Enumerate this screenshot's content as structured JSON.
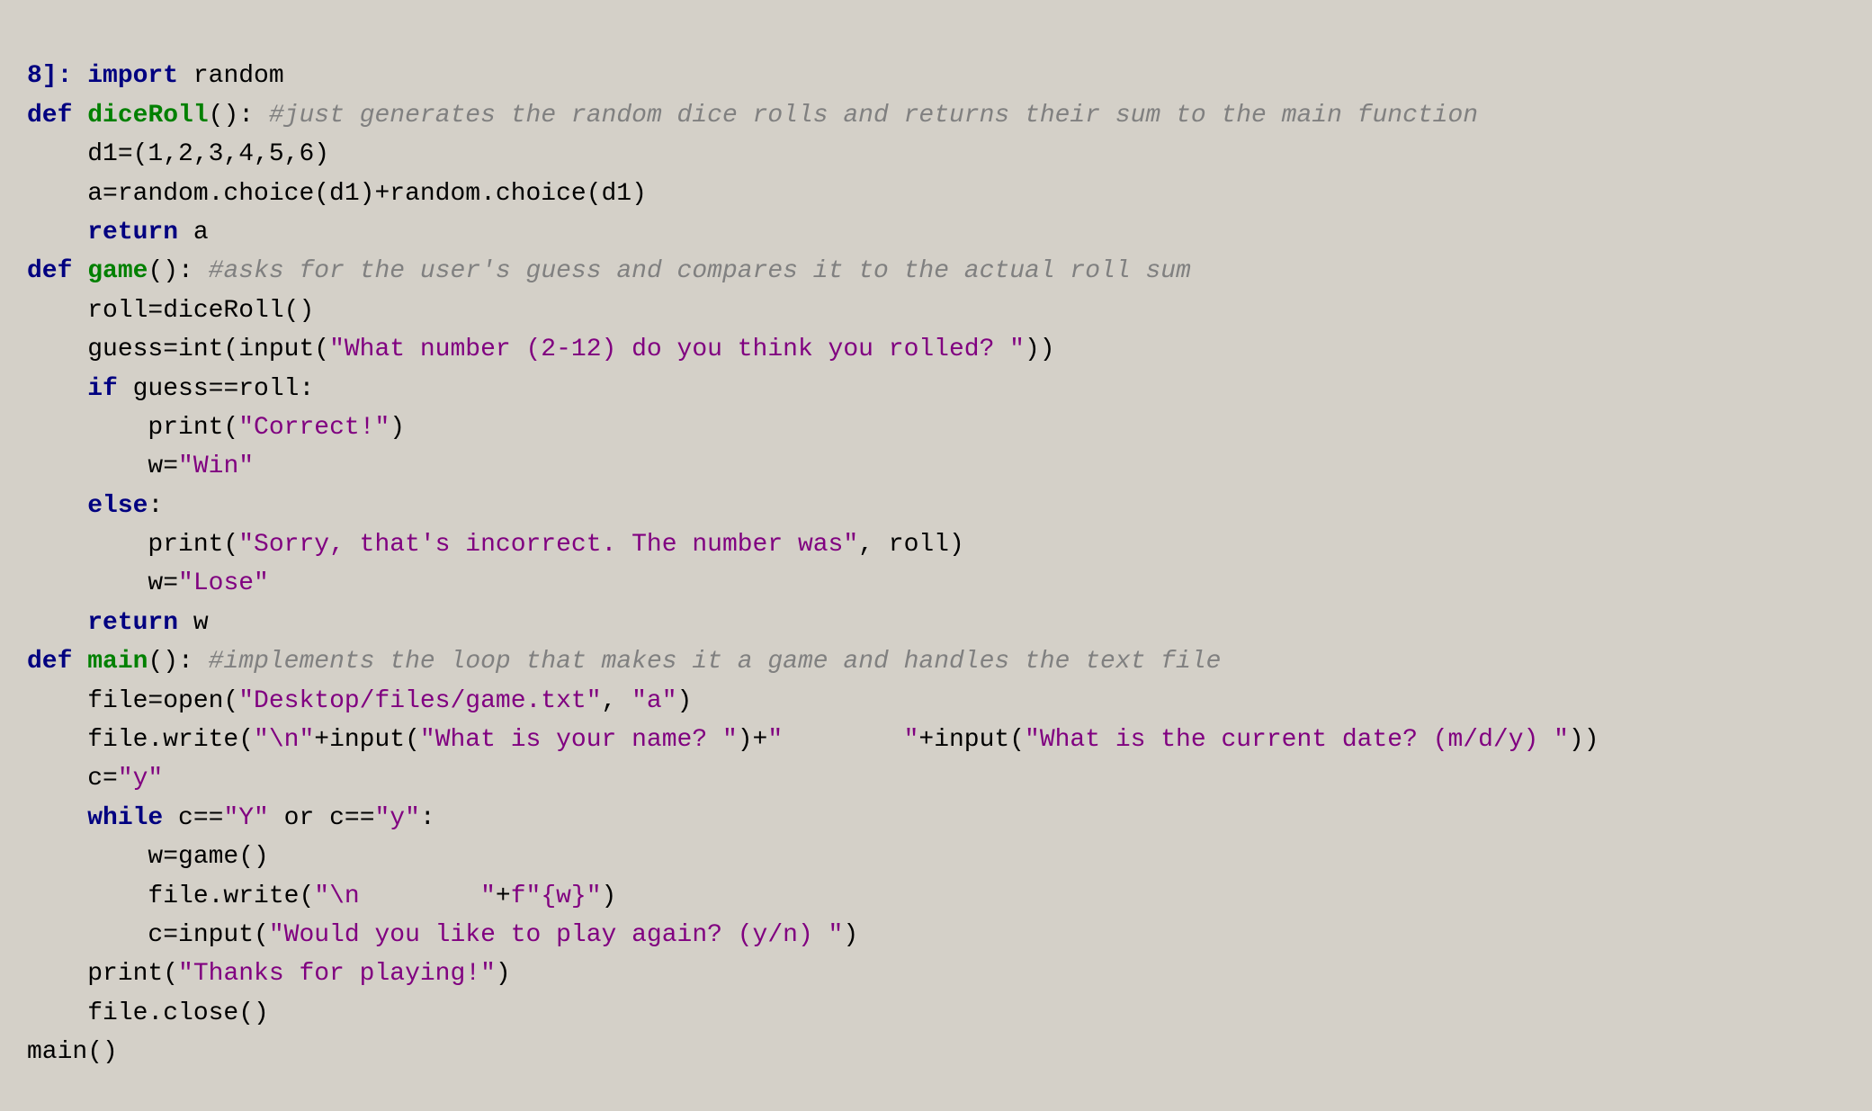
{
  "cell_number": "8]:",
  "code_lines": [
    {
      "id": "line1",
      "content": "import random"
    },
    {
      "id": "line2",
      "content": "def diceRoll(): #just generates the random dice rolls and returns their sum to the main function"
    },
    {
      "id": "line3",
      "content": "    d1=(1,2,3,4,5,6)"
    },
    {
      "id": "line4",
      "content": "    a=random.choice(d1)+random.choice(d1)"
    },
    {
      "id": "line5",
      "content": "    return a"
    },
    {
      "id": "line6",
      "content": "def game(): #asks for the user's guess and compares it to the actual roll sum"
    },
    {
      "id": "line7",
      "content": "    roll=diceRoll()"
    },
    {
      "id": "line8",
      "content": "    guess=int(input(\"What number (2-12) do you think you rolled? \"))"
    },
    {
      "id": "line9",
      "content": "    if guess==roll:"
    },
    {
      "id": "line10",
      "content": "        print(\"Correct!\")"
    },
    {
      "id": "line11",
      "content": "        w=\"Win\""
    },
    {
      "id": "line12",
      "content": "    else:"
    },
    {
      "id": "line13",
      "content": "        print(\"Sorry, that's incorrect. The number was\", roll)"
    },
    {
      "id": "line14",
      "content": "        w=\"Lose\""
    },
    {
      "id": "line15",
      "content": "    return w"
    },
    {
      "id": "line16",
      "content": "def main(): #implements the loop that makes it a game and handles the text file"
    },
    {
      "id": "line17",
      "content": "    file=open(\"Desktop/files/game.txt\", \"a\")"
    },
    {
      "id": "line18",
      "content": "    file.write(\"\\n\"+input(\"What is your name? \")+\"        \"+input(\"What is the current date? (m/d/y) \"))"
    },
    {
      "id": "line19",
      "content": "    c=\"y\""
    },
    {
      "id": "line20",
      "content": "    while c==\"Y\" or c==\"y\":"
    },
    {
      "id": "line21",
      "content": "        w=game()"
    },
    {
      "id": "line22",
      "content": "        file.write(\"\\n        \"+f\"{w}\")"
    },
    {
      "id": "line23",
      "content": "        c=input(\"Would you like to play again? (y/n) \")"
    },
    {
      "id": "line24",
      "content": "    print(\"Thanks for playing!\")"
    },
    {
      "id": "line25",
      "content": "    file.close()"
    },
    {
      "id": "line26",
      "content": "main()"
    }
  ]
}
